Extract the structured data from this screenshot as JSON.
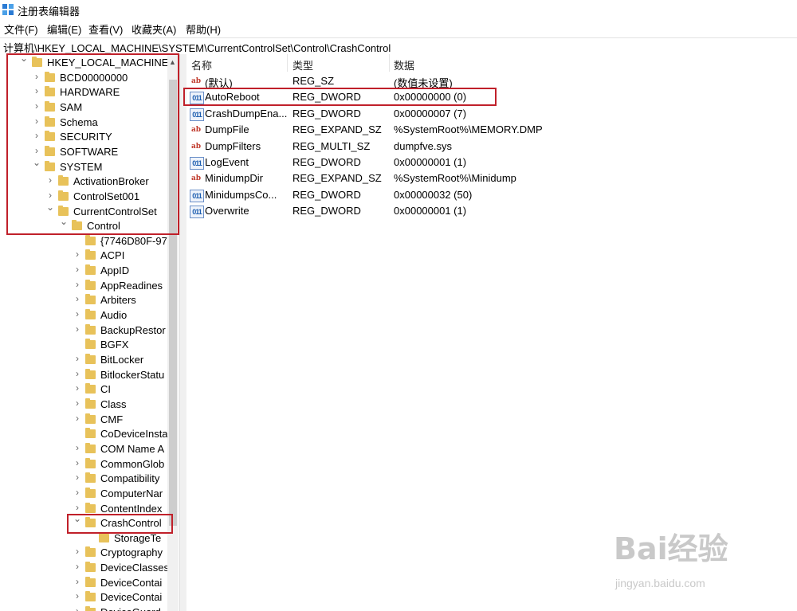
{
  "window": {
    "title": "注册表编辑器"
  },
  "menu": [
    "文件(F)",
    "编辑(E)",
    "查看(V)",
    "收藏夹(A)",
    "帮助(H)"
  ],
  "address": "计算机\\HKEY_LOCAL_MACHINE\\SYSTEM\\CurrentControlSet\\Control\\CrashControl",
  "tree": [
    {
      "label": "HKEY_LOCAL_MACHINE",
      "chevron": "v",
      "level": 0
    },
    {
      "label": "BCD00000000",
      "chevron": ">",
      "level": 1
    },
    {
      "label": "HARDWARE",
      "chevron": ">",
      "level": 1
    },
    {
      "label": "SAM",
      "chevron": ">",
      "level": 1
    },
    {
      "label": "Schema",
      "chevron": ">",
      "level": 1
    },
    {
      "label": "SECURITY",
      "chevron": ">",
      "level": 1
    },
    {
      "label": "SOFTWARE",
      "chevron": ">",
      "level": 1
    },
    {
      "label": "SYSTEM",
      "chevron": "v",
      "level": 1
    },
    {
      "label": "ActivationBroker",
      "chevron": ">",
      "level": 2
    },
    {
      "label": "ControlSet001",
      "chevron": ">",
      "level": 2
    },
    {
      "label": "CurrentControlSet",
      "chevron": "v",
      "level": 2
    },
    {
      "label": "Control",
      "chevron": "v",
      "level": 3
    },
    {
      "label": "{7746D80F-97",
      "chevron": "",
      "level": 4
    },
    {
      "label": "ACPI",
      "chevron": ">",
      "level": 4
    },
    {
      "label": "AppID",
      "chevron": ">",
      "level": 4
    },
    {
      "label": "AppReadines",
      "chevron": ">",
      "level": 4
    },
    {
      "label": "Arbiters",
      "chevron": ">",
      "level": 4
    },
    {
      "label": "Audio",
      "chevron": ">",
      "level": 4
    },
    {
      "label": "BackupRestor",
      "chevron": ">",
      "level": 4
    },
    {
      "label": "BGFX",
      "chevron": "",
      "level": 4
    },
    {
      "label": "BitLocker",
      "chevron": ">",
      "level": 4
    },
    {
      "label": "BitlockerStatu",
      "chevron": ">",
      "level": 4
    },
    {
      "label": "CI",
      "chevron": ">",
      "level": 4
    },
    {
      "label": "Class",
      "chevron": ">",
      "level": 4
    },
    {
      "label": "CMF",
      "chevron": ">",
      "level": 4
    },
    {
      "label": "CoDeviceInsta",
      "chevron": "",
      "level": 4
    },
    {
      "label": "COM Name A",
      "chevron": ">",
      "level": 4
    },
    {
      "label": "CommonGlob",
      "chevron": ">",
      "level": 4
    },
    {
      "label": "Compatibility",
      "chevron": ">",
      "level": 4
    },
    {
      "label": "ComputerNar",
      "chevron": ">",
      "level": 4
    },
    {
      "label": "ContentIndex",
      "chevron": ">",
      "level": 4
    },
    {
      "label": "CrashControl",
      "chevron": "v",
      "level": 4
    },
    {
      "label": "StorageTe",
      "chevron": "",
      "level": 5
    },
    {
      "label": "Cryptography",
      "chevron": ">",
      "level": 4
    },
    {
      "label": "DeviceClasses",
      "chevron": ">",
      "level": 4
    },
    {
      "label": "DeviceContai",
      "chevron": ">",
      "level": 4
    },
    {
      "label": "DeviceContai",
      "chevron": ">",
      "level": 4
    },
    {
      "label": "DeviceGuard",
      "chevron": ">",
      "level": 4
    }
  ],
  "list": {
    "headers": [
      "名称",
      "类型",
      "数据"
    ],
    "rows": [
      {
        "icon": "ab",
        "name": "(默认)",
        "type": "REG_SZ",
        "data": "(数值未设置)"
      },
      {
        "icon": "bin",
        "name": "AutoReboot",
        "type": "REG_DWORD",
        "data": "0x00000000 (0)"
      },
      {
        "icon": "bin",
        "name": "CrashDumpEna...",
        "type": "REG_DWORD",
        "data": "0x00000007 (7)"
      },
      {
        "icon": "ab",
        "name": "DumpFile",
        "type": "REG_EXPAND_SZ",
        "data": "%SystemRoot%\\MEMORY.DMP"
      },
      {
        "icon": "ab",
        "name": "DumpFilters",
        "type": "REG_MULTI_SZ",
        "data": "dumpfve.sys"
      },
      {
        "icon": "bin",
        "name": "LogEvent",
        "type": "REG_DWORD",
        "data": "0x00000001 (1)"
      },
      {
        "icon": "ab",
        "name": "MinidumpDir",
        "type": "REG_EXPAND_SZ",
        "data": "%SystemRoot%\\Minidump"
      },
      {
        "icon": "bin",
        "name": "MinidumpsCo...",
        "type": "REG_DWORD",
        "data": "0x00000032 (50)"
      },
      {
        "icon": "bin",
        "name": "Overwrite",
        "type": "REG_DWORD",
        "data": "0x00000001 (1)"
      }
    ]
  },
  "watermark": {
    "brand": "Bai经验",
    "url": "jingyan.baidu.com"
  },
  "colors": {
    "highlight_box": "#c0202a",
    "folder": "#e8c25a"
  }
}
